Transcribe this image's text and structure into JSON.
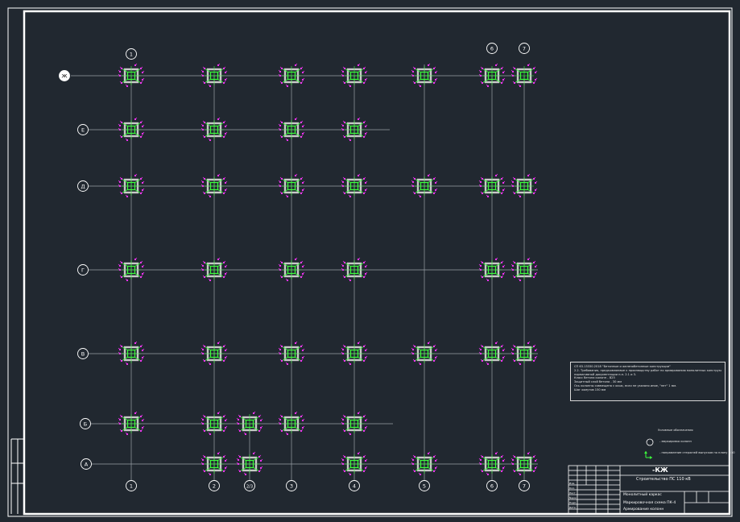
{
  "drawing": {
    "code": "-КЖ",
    "building": "Строительство ПС 110 кВ",
    "sheet_title": "Монолитный каркас",
    "plan_name": "Маркировочная схема ПК-4",
    "plan_sub": "Армирование колонн",
    "stamp_rows": [
      "Изм.",
      "Кол.",
      "Лист",
      "№док",
      "Подп.",
      "Дата"
    ]
  },
  "grid": {
    "columns": [
      {
        "label": "1"
      },
      {
        "label": "2"
      },
      {
        "label": "2/3"
      },
      {
        "label": "3"
      },
      {
        "label": "4"
      },
      {
        "label": "5"
      },
      {
        "label": "6"
      },
      {
        "label": "7"
      }
    ],
    "rows": [
      {
        "label": "Ж"
      },
      {
        "label": "Е"
      },
      {
        "label": "Д"
      },
      {
        "label": "Г"
      },
      {
        "label": "В"
      },
      {
        "label": "Б"
      },
      {
        "label": "А"
      }
    ],
    "top_markers": [
      "1",
      "6",
      "7"
    ]
  },
  "notes": {
    "lines": [
      "СП 63.13330.2018 \"Бетонные и железобетонные конструкции\"",
      "2.2. Требования, предъявляемые к производству работ по армированию монолитных конструкций, выполнять по",
      "нормативной документации п.п. 2.1 и 3.",
      "Класс бетона колонн - В25",
      "Защитный слой бетона - 30 мм",
      "",
      "Ось колонны совмещена с осью, если не указано иное, \"нет\" 1 мм.",
      "Шаг хомутов 150 мм"
    ]
  },
  "legend": {
    "title": "Условные обозначения",
    "item1": "- маркировка колонн",
    "item2": "- направление стержней выпусков по плану 1:50"
  },
  "colors": {
    "background": "#212830",
    "frame": "#ffffff",
    "grid_line": "#9aa0a6",
    "column": "#c8c8c8",
    "rebar": "#3cff3c",
    "marker": "#ff33ff"
  }
}
